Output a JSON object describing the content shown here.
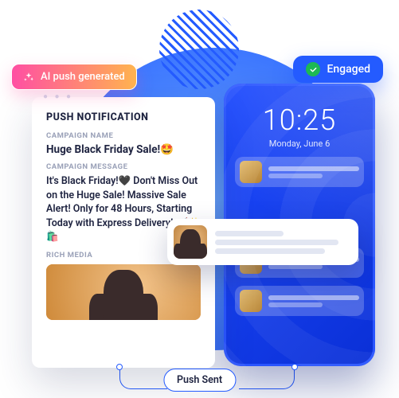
{
  "ai_badge": {
    "label": "AI push generated"
  },
  "engaged_badge": {
    "label": "Engaged"
  },
  "panel": {
    "title": "PUSH NOTIFICATION",
    "campaign_name_label": "CAMPAIGN NAME",
    "campaign_name": "Huge Black Friday Sale!🤩",
    "campaign_message_label": "CAMPAIGN MESSAGE",
    "campaign_message": "It's Black Friday!🖤 Don't Miss Out on the Huge Sale! Massive Sale Alert! Only for 48 Hours, Starting Today with Express Delivery! 🛒✨🛍️",
    "rich_media_label": "RICH MEDIA"
  },
  "phone": {
    "time": "10:25",
    "date": "Monday, June 6"
  },
  "sent_pill": {
    "label": "Push Sent"
  }
}
